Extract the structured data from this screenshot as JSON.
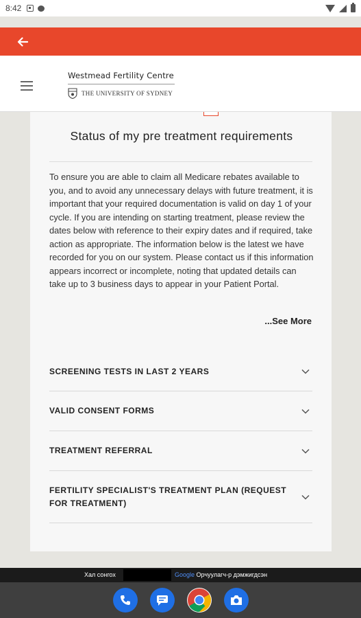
{
  "status_bar": {
    "time": "8:42"
  },
  "header": {
    "logo_title": "Westmead Fertility Centre",
    "logo_subtitle": "THE UNIVERSITY OF SYDNEY"
  },
  "card": {
    "title": "Status of my pre treatment requirements",
    "body": "To ensure you are able to claim all Medicare rebates available to you, and to avoid any unnecessary delays with future treatment, it is important that your required documentation is valid on day 1 of your cycle. If you are intending on starting treatment, please review the dates below with reference to their expiry dates and if required, take action as appropriate. The information below is the latest we have recorded for you on our system. Please contact us if this information appears incorrect or incomplete, noting that updated details can take up to 3 business days to appear in your Patient Portal.",
    "see_more": "...See More",
    "sections": [
      {
        "label": "SCREENING TESTS IN LAST 2 YEARS"
      },
      {
        "label": "VALID CONSENT FORMS"
      },
      {
        "label": "TREATMENT REFERRAL"
      },
      {
        "label": "FERTILITY SPECIALIST'S TREATMENT PLAN (REQUEST FOR TREATMENT)"
      }
    ]
  },
  "ticker": {
    "left": "Хал сонгох",
    "brand": "Google",
    "right": "Орчуулагч-р дэмжигдсэн"
  },
  "colors": {
    "accent": "#e8472b",
    "card": "#f7f7f7",
    "background": "#e6e5e0"
  },
  "icons": [
    "back-arrow-icon",
    "menu-icon",
    "chevron-down-icon",
    "phone-icon",
    "messages-icon",
    "chrome-icon",
    "camera-icon"
  ]
}
